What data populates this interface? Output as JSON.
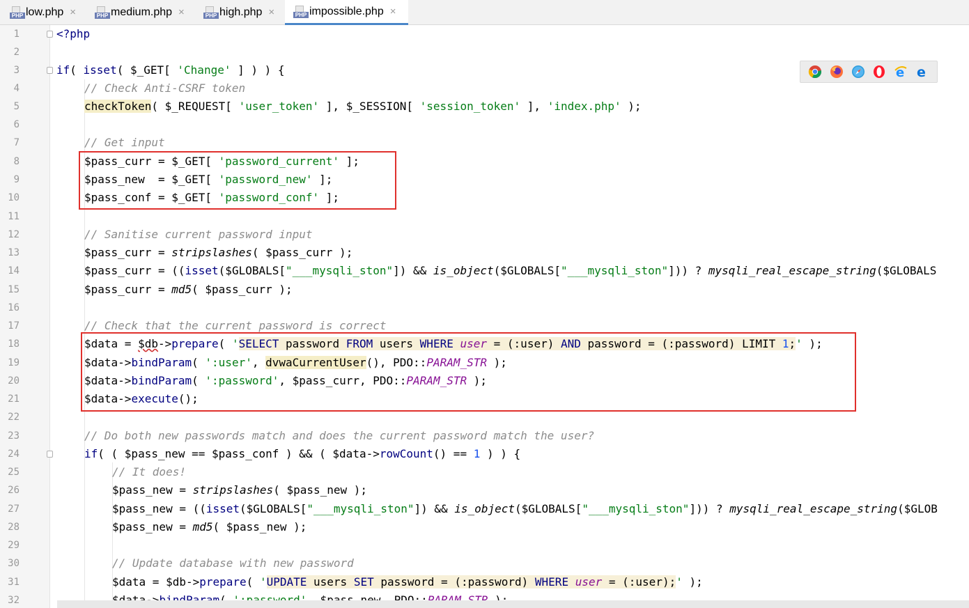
{
  "tabs": [
    {
      "label": "low.php",
      "icon": "php-file-icon",
      "active": false
    },
    {
      "label": "medium.php",
      "icon": "php-file-icon",
      "active": false
    },
    {
      "label": "high.php",
      "icon": "php-file-icon",
      "active": false
    },
    {
      "label": "impossible.php",
      "icon": "php-file-icon",
      "active": true
    }
  ],
  "file_icon_label": "PHP",
  "close_glyph": "×",
  "browsers": [
    "chrome-icon",
    "firefox-icon",
    "safari-icon",
    "opera-icon",
    "ie-icon",
    "edge-icon"
  ],
  "line_numbers": [
    "1",
    "2",
    "3",
    "4",
    "5",
    "6",
    "7",
    "8",
    "9",
    "10",
    "11",
    "12",
    "13",
    "14",
    "15",
    "16",
    "17",
    "18",
    "19",
    "20",
    "21",
    "22",
    "23",
    "24",
    "25",
    "26",
    "27",
    "28",
    "29",
    "30",
    "31",
    "32"
  ],
  "code": {
    "l1": "<?php",
    "l3a": "if",
    "l3b": "( ",
    "l3c": "isset",
    "l3d": "( $_GET[ ",
    "l3e": "'Change'",
    "l3f": " ] ) ) {",
    "l4": "// Check Anti-CSRF token",
    "l5a": "checkToken",
    "l5b": "( $_REQUEST[ ",
    "l5c": "'user_token'",
    "l5d": " ], $_SESSION[ ",
    "l5e": "'session_token'",
    "l5f": " ], ",
    "l5g": "'index.php'",
    "l5h": " );",
    "l7": "// Get input",
    "l8a": "$pass_curr = $_GET[ ",
    "l8b": "'password_current'",
    "l8c": " ];",
    "l9a": "$pass_new  = $_GET[ ",
    "l9b": "'password_new'",
    "l9c": " ];",
    "l10a": "$pass_conf = $_GET[ ",
    "l10b": "'password_conf'",
    "l10c": " ];",
    "l12": "// Sanitise current password input",
    "l13a": "$pass_curr = ",
    "l13b": "stripslashes",
    "l13c": "( $pass_curr );",
    "l14a": "$pass_curr = ((",
    "l14b": "isset",
    "l14c": "($GLOBALS[",
    "l14d": "\"___mysqli_ston\"",
    "l14e": "]) && ",
    "l14f": "is_object",
    "l14g": "($GLOBALS[",
    "l14h": "\"___mysqli_ston\"",
    "l14i": "])) ? ",
    "l14j": "mysqli_real_escape_string",
    "l14k": "($GLOBALS",
    "l15a": "$pass_curr = ",
    "l15b": "md5",
    "l15c": "( $pass_curr );",
    "l17": "// Check that the current password is correct",
    "l18a": "$data = ",
    "l18b": "$db",
    "l18c": "->",
    "l18d": "prepare",
    "l18e": "( ",
    "l18f": "'",
    "l18g": "SELECT",
    "l18h": " password ",
    "l18i": "FROM",
    "l18j": " users ",
    "l18k": "WHERE",
    "l18l": " ",
    "l18m": "user",
    "l18n": " = (:user) ",
    "l18o": "AND",
    "l18p": " password = (:password) LIMIT ",
    "l18q": "1",
    "l18r": ";",
    "l18s": "'",
    "l18t": " );",
    "l19a": "$data->",
    "l19b": "bindParam",
    "l19c": "( ",
    "l19d": "':user'",
    "l19e": ", ",
    "l19f": "dvwaCurrentUser",
    "l19g": "(), PDO::",
    "l19h": "PARAM_STR",
    "l19i": " );",
    "l20a": "$data->",
    "l20b": "bindParam",
    "l20c": "( ",
    "l20d": "':password'",
    "l20e": ", $pass_curr, PDO::",
    "l20f": "PARAM_STR",
    "l20g": " );",
    "l21a": "$data->",
    "l21b": "execute",
    "l21c": "();",
    "l23": "// Do both new passwords match and does the current password match the user?",
    "l24a": "if",
    "l24b": "( ( $pass_new == $pass_conf ) && ( $data->",
    "l24c": "rowCount",
    "l24d": "() == ",
    "l24e": "1",
    "l24f": " ) ) {",
    "l25": "// It does!",
    "l26a": "$pass_new = ",
    "l26b": "stripslashes",
    "l26c": "( $pass_new );",
    "l27a": "$pass_new = ((",
    "l27b": "isset",
    "l27c": "($GLOBALS[",
    "l27d": "\"___mysqli_ston\"",
    "l27e": "]) && ",
    "l27f": "is_object",
    "l27g": "($GLOBALS[",
    "l27h": "\"___mysqli_ston\"",
    "l27i": "])) ? ",
    "l27j": "mysqli_real_escape_string",
    "l27k": "($GLOB",
    "l28a": "$pass_new = ",
    "l28b": "md5",
    "l28c": "( $pass_new );",
    "l30": "// Update database with new password",
    "l31a": "$data = $db->",
    "l31b": "prepare",
    "l31c": "( ",
    "l31d": "'",
    "l31e": "UPDATE",
    "l31f": " users ",
    "l31g": "SET",
    "l31h": " password = (:password) ",
    "l31i": "WHERE",
    "l31j": " ",
    "l31k": "user",
    "l31l": " = (:user);",
    "l31m": "'",
    "l31n": " );",
    "l32a": "$data->",
    "l32b": "bindParam",
    "l32c": "( ",
    "l32d": "':password'",
    "l32e": ", $pass_new, PDO::",
    "l32f": "PARAM_STR",
    "l32g": " );"
  },
  "colors": {
    "keyword": "#000080",
    "string": "#067d17",
    "comment": "#8c8c8c",
    "constant": "#871094",
    "annotation_box": "#e0302c"
  }
}
